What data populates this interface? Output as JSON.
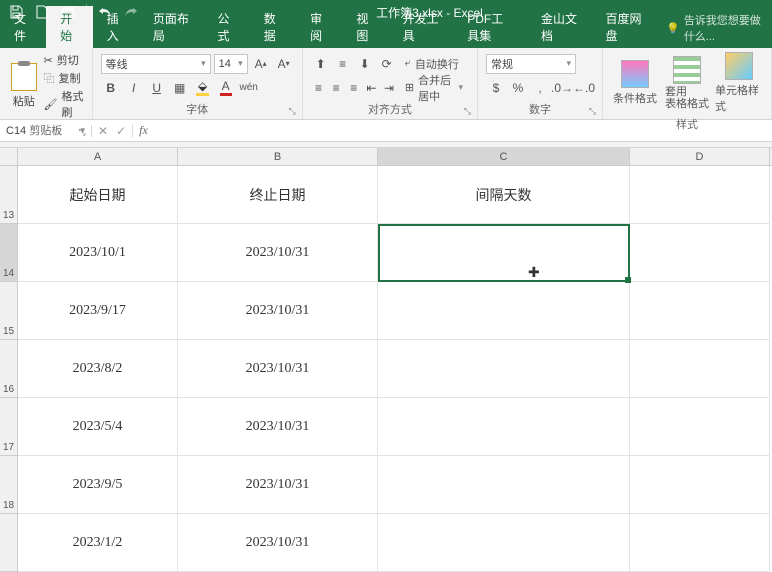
{
  "title": "工作簿3.xlsx - Excel",
  "tabs": [
    "文件",
    "开始",
    "插入",
    "页面布局",
    "公式",
    "数据",
    "审阅",
    "视图",
    "开发工具",
    "PDF工具集",
    "金山文档",
    "百度网盘"
  ],
  "active_tab": "开始",
  "tell_me": "告诉我您想要做什么...",
  "clipboard": {
    "paste": "粘贴",
    "cut": "剪切",
    "copy": "复制",
    "painter": "格式刷",
    "label": "剪贴板"
  },
  "font": {
    "name": "等线",
    "size": "14",
    "label": "字体"
  },
  "alignment": {
    "wrap": "自动换行",
    "merge": "合并后居中",
    "label": "对齐方式"
  },
  "number": {
    "format": "常规",
    "label": "数字"
  },
  "styles": {
    "cond": "条件格式",
    "table": "套用\n表格格式",
    "cell": "单元格样式",
    "label": "样式"
  },
  "name_box": "C14",
  "formula": "",
  "columns": [
    "A",
    "B",
    "C",
    "D"
  ],
  "row_numbers": [
    "13",
    "14",
    "15",
    "16",
    "17",
    "18",
    ""
  ],
  "headers": [
    "起始日期",
    "终止日期",
    "间隔天数"
  ],
  "data_rows": [
    {
      "a": "2023/10/1",
      "b": "2023/10/31"
    },
    {
      "a": "2023/9/17",
      "b": "2023/10/31"
    },
    {
      "a": "2023/8/2",
      "b": "2023/10/31"
    },
    {
      "a": "2023/5/4",
      "b": "2023/10/31"
    },
    {
      "a": "2023/9/5",
      "b": "2023/10/31"
    },
    {
      "a": "2023/1/2",
      "b": "2023/10/31"
    }
  ],
  "selected_cell": {
    "row": 1,
    "col": "C"
  }
}
